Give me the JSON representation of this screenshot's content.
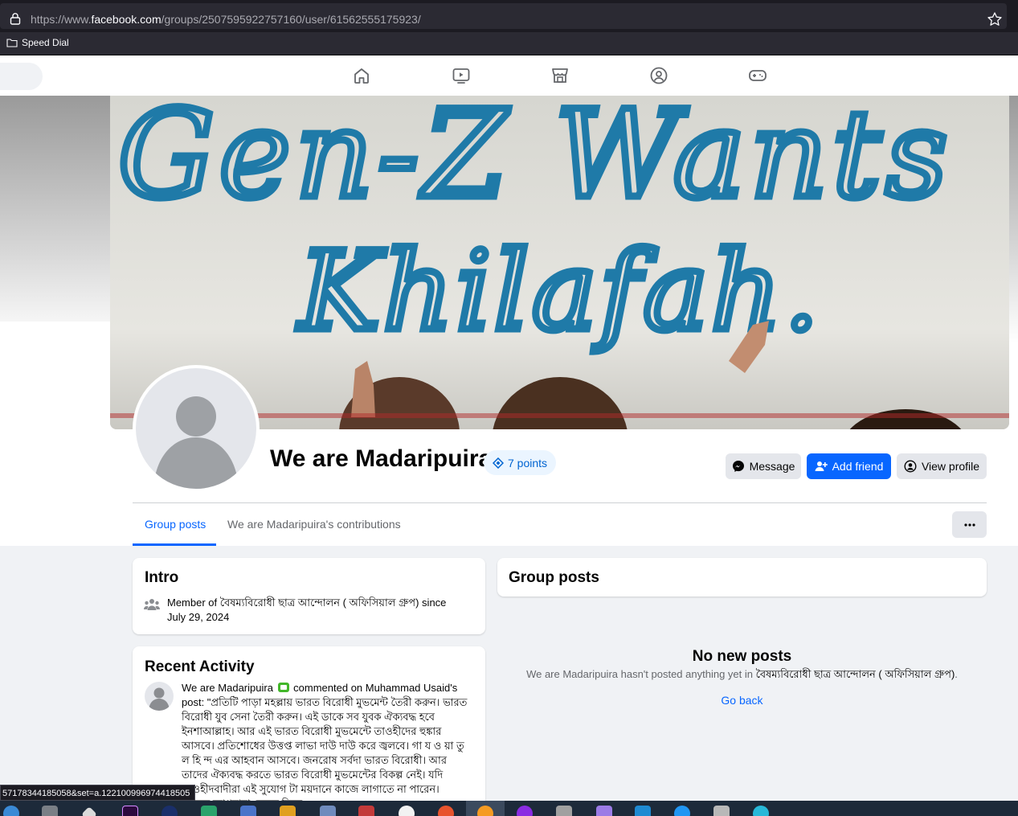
{
  "browser": {
    "url_prefix": "https://www.",
    "url_domain": "facebook.com",
    "url_path": "/groups/2507595922757160/user/61562555175923/",
    "bookmark_folder": "Speed Dial"
  },
  "fb_nav": {
    "icons": [
      "home-icon",
      "watch-icon",
      "marketplace-icon",
      "groups-icon",
      "gaming-icon"
    ]
  },
  "cover": {
    "line1": "Gen-Z Wants",
    "line2": "Khilafah."
  },
  "profile": {
    "name": "We are Madaripuira",
    "points": "7 points",
    "buttons": {
      "message": "Message",
      "add_friend": "Add friend",
      "view_profile": "View profile"
    }
  },
  "tabs": {
    "group_posts": "Group posts",
    "contributions": "We are Madaripuira's contributions"
  },
  "intro": {
    "title": "Intro",
    "member_prefix": "Member of ",
    "group_name": "বৈষম্যবিরোধী ছাত্র আন্দোলন ( অফিসিয়াল গ্রুপ)",
    "member_suffix": " since",
    "since_date": "July 29, 2024"
  },
  "recent_activity": {
    "title": "Recent Activity",
    "actor": "We are Madaripuira",
    "verb": " commented on ",
    "target": "Muhammad Usaid",
    "post_prefix": "'s post: \"",
    "comment": "প্রতিটি পাড়া মহল্লায় ভারত বিরোধী মুভমেন্ট তৈরী করুন। ভারত বিরোধী যুব সেনা তৈরী করুন। এই ডাকে সব যুবক ঐক্যবদ্ধ হবে ইনশাআল্লাহ। আর এই ভারত বিরোধী মুভমেন্টে তাওহীদের হুঙ্কার আসবে। প্রতিশোধের উত্তপ্ত লাভা দাউ দাউ করে জ্বলবে। গা য ও য়া তু ল হি ন্দ এর আহবান আসবে। জনরোষ সর্বদা ভারত বিরোধী। আর তাদের ঐক্যবদ্ধ করতে ভারত বিরোধী মুভমেন্টের বিকল্প নেই। যদি তাওহীদবাদীরা এই সুযোগ টা ময়দানে কাজে লাগাতে না পারেন। তাহলে আপনারা নেতৃত্ব দিতে"
  },
  "group_posts": {
    "title": "Group posts",
    "empty_title": "No new posts",
    "empty_prefix": "We are Madaripuira hasn't posted anything yet in ",
    "empty_group": "বৈষম্যবিরোধী ছাত্র আন্দোলন ( অফিসিয়াল গ্রুপ)",
    "empty_suffix": ".",
    "go_back": "Go back"
  },
  "status_link": "57178344185058&set=a.122100996974418505",
  "colors": {
    "fb_blue": "#0866ff",
    "page_bg": "#f0f2f5",
    "points_bg": "#ebf5ff"
  }
}
